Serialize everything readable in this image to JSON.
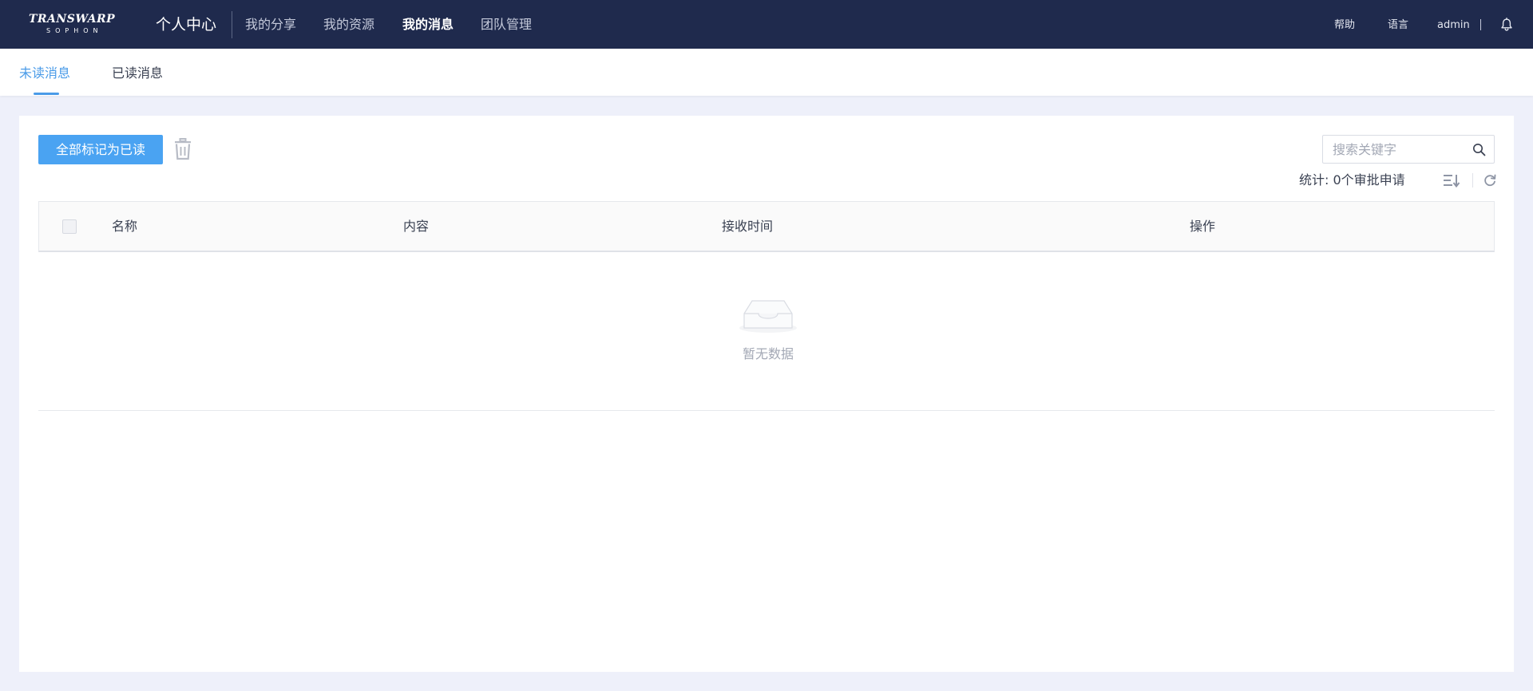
{
  "header": {
    "logo_top": "TRANSWARP",
    "logo_bottom": "SOPHON",
    "app_title": "个人中心",
    "nav": [
      {
        "label": "我的分享"
      },
      {
        "label": "我的资源"
      },
      {
        "label": "我的消息",
        "active": true
      },
      {
        "label": "团队管理"
      }
    ],
    "help": "帮助",
    "language": "语言",
    "user": "admin",
    "bell_icon": "bell-icon"
  },
  "tabs": [
    {
      "label": "未读消息",
      "active": true
    },
    {
      "label": "已读消息"
    }
  ],
  "toolbar": {
    "mark_all_read": "全部标记为已读",
    "delete_icon": "trash-icon",
    "search_placeholder": "搜索关键字",
    "stats": "统计: 0个审批申请",
    "sort_icon": "sort-icon",
    "refresh_icon": "refresh-icon"
  },
  "table": {
    "columns": [
      "名称",
      "内容",
      "接收时间",
      "操作"
    ],
    "rows": [],
    "empty_text": "暂无数据"
  },
  "colors": {
    "topbar": "#1f2a4d",
    "accent": "#4a9be8",
    "button": "#4aa3f2",
    "page_bg": "#eef0fa"
  }
}
